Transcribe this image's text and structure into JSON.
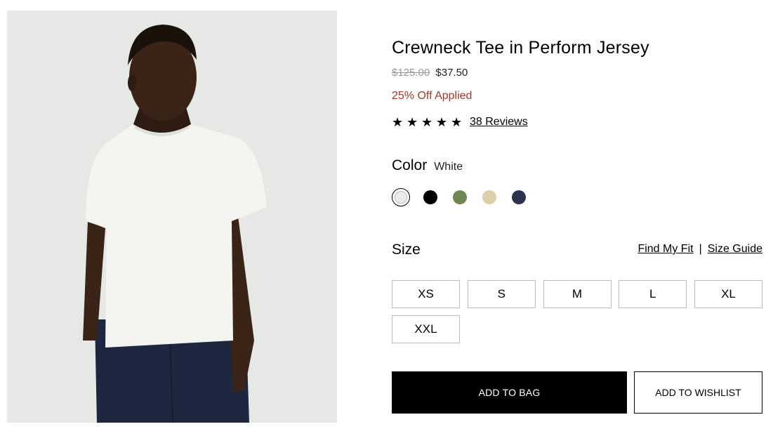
{
  "product": {
    "title": "Crewneck Tee in Perform Jersey",
    "price_original": "$125.00",
    "price_sale": "$37.50",
    "discount_text": "25% Off Applied",
    "rating": {
      "stars": 5,
      "star_glyph": "★",
      "reviews_text": "38 Reviews"
    }
  },
  "color": {
    "label": "Color",
    "selected_value": "White",
    "swatches": [
      {
        "name": "White",
        "hex": "#ebebea",
        "selected": true
      },
      {
        "name": "Black",
        "hex": "#000000",
        "selected": false
      },
      {
        "name": "Olive",
        "hex": "#6e8654",
        "selected": false
      },
      {
        "name": "Khaki",
        "hex": "#dcd0ac",
        "selected": false
      },
      {
        "name": "Navy",
        "hex": "#2a3350",
        "selected": false
      }
    ]
  },
  "size": {
    "label": "Size",
    "find_fit_link": "Find My Fit",
    "separator": "|",
    "guide_link": "Size Guide",
    "options": [
      "XS",
      "S",
      "M",
      "L",
      "XL",
      "XXL"
    ]
  },
  "actions": {
    "add_to_bag": "ADD TO BAG",
    "add_to_wishlist": "ADD TO WISHLIST"
  },
  "colors": {
    "discount": "#9c3a2a",
    "price_old": "#9a9a9a",
    "image_bg": "#e6e8e6"
  }
}
